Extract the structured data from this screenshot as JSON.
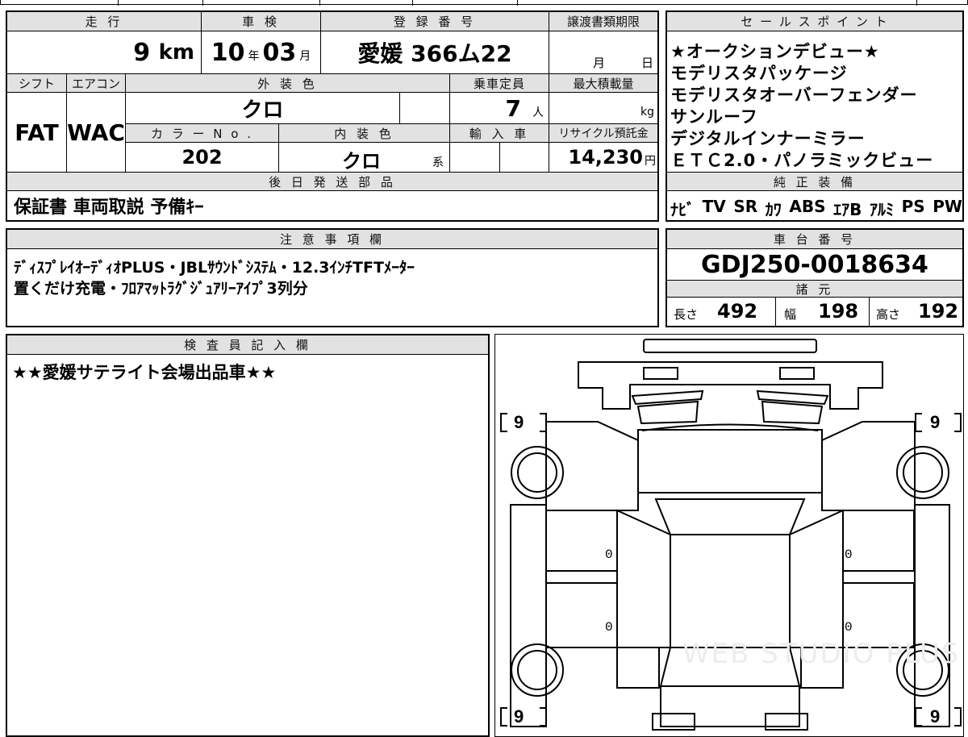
{
  "top_strip": [
    "",
    "",
    "",
    "",
    "",
    ""
  ],
  "mileage": {
    "label": "走 行",
    "value": "9",
    "unit": "km"
  },
  "inspection": {
    "label": "車 検",
    "year": "10",
    "year_unit": "年",
    "month": "03",
    "month_unit": "月"
  },
  "registration": {
    "label": "登 録 番 号",
    "value": "愛媛 366ム22"
  },
  "transfer_deadline": {
    "label": "譲渡書類期限",
    "month_unit": "月",
    "day_unit": "日"
  },
  "shift": {
    "label": "シフト",
    "value": "FAT"
  },
  "aircon": {
    "label": "エアコン",
    "value": "WAC"
  },
  "exterior_color": {
    "label": "外 装 色",
    "value": "クロ"
  },
  "capacity": {
    "label": "乗車定員",
    "value": "7",
    "unit": "人"
  },
  "max_load": {
    "label": "最大積載量",
    "unit": "kg"
  },
  "color_no": {
    "label": "カ ラ ー N o .",
    "value": "202"
  },
  "interior_color": {
    "label": "内 装 色",
    "value": "クロ",
    "suffix": "系"
  },
  "import": {
    "label": "輸 入 車"
  },
  "recycle": {
    "label": "リサイクル預託金",
    "value": "14,230",
    "unit": "円"
  },
  "shipping": {
    "label": "後 日 発 送 部 品",
    "value": "保証書 車両取説 予備ｷｰ"
  },
  "sales_points": {
    "label": "セ ー ル ス ポ イ ン ト",
    "lines": [
      "★オークションデビュー★",
      "モデリスタパッケージ",
      "モデリスタオーバーフェンダー",
      "サンルーフ",
      "デジタルインナーミラー",
      "ＥＴＣ2.0・パノラミックビュー"
    ]
  },
  "equipment": {
    "label": "純 正 装 備",
    "items": [
      "ﾅﾋﾞ",
      "TV",
      "SR",
      "ｶﾜ",
      "ABS",
      "ｴｱB",
      "ｱﾙﾐ",
      "PS",
      "PW"
    ]
  },
  "notes": {
    "label": "注 意 事 項 欄",
    "lines": [
      "ﾃﾞｨｽﾌﾟﾚｲｵｰﾃﾞｨｵPLUS・JBLｻｳﾝﾄﾞｼｽﾃﾑ・12.3ｲﾝﾁTFTﾒｰﾀｰ",
      "置くだけ充電・ﾌﾛｱﾏｯﾄﾗｸﾞｼﾞｭｱﾘｰｱｲﾌﾟ3列分"
    ]
  },
  "chassis": {
    "label": "車 台 番 号",
    "value": "GDJ250-0018634"
  },
  "specs": {
    "label": "諸 元",
    "length_label": "長さ",
    "length": "492",
    "width_label": "幅",
    "width": "198",
    "height_label": "高さ",
    "height": "192"
  },
  "inspector": {
    "label": "検 査 員 記 入 欄",
    "text": "★★愛媛サテライト会場出品車★★"
  },
  "diagram": {
    "tread_fl": "9",
    "tread_fr": "9",
    "tread_rl": "9",
    "tread_rr": "9",
    "door_l_front": "0",
    "door_l_rear": "0",
    "door_r_front": "0",
    "door_r_rear": "0",
    "watermark": "WEB STUDIO PLUS"
  }
}
